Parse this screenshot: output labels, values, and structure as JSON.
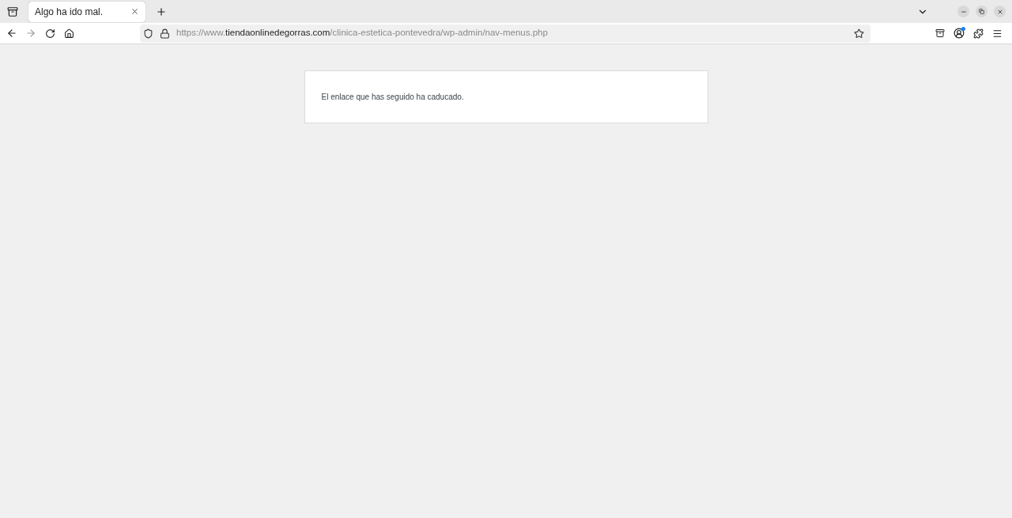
{
  "tabs": [
    {
      "title": "Algo ha ido mal.",
      "selected": true
    }
  ],
  "address_bar": {
    "url_prefix": "https://www.",
    "url_host": "tiendaonlinedegorras.com",
    "url_path": "/clinica-estetica-pontevedra/wp-admin/nav-menus.php"
  },
  "toolbar": {
    "account_notification": true
  },
  "page": {
    "message": "El enlace que has seguido ha caducado."
  }
}
